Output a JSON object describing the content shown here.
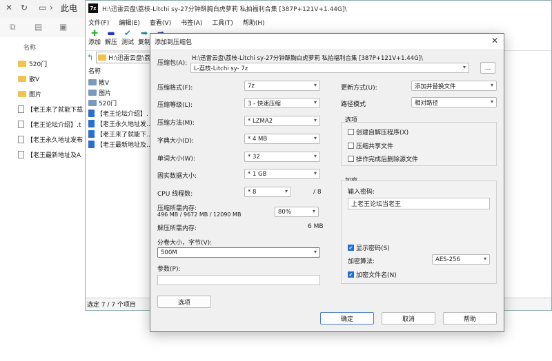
{
  "explorer": {
    "path": "此电",
    "header": "名称",
    "items": [
      {
        "label": "520门",
        "kind": "folder"
      },
      {
        "label": "散V",
        "kind": "folder"
      },
      {
        "label": "图片",
        "kind": "folder"
      },
      {
        "label": "【老王来了就能下载",
        "kind": "doc"
      },
      {
        "label": "【老王论坛介绍】.t",
        "kind": "doc"
      },
      {
        "label": "【老王永久地址发布",
        "kind": "doc"
      },
      {
        "label": "【老王最新地址及A",
        "kind": "doc"
      }
    ]
  },
  "fm": {
    "logo": "7z",
    "title": "H:\\迅雷云盘\\荔枝-Litchi sy-27分钟酥胸白虎萝莉 私拍福利合集 [387P+121V+1.44G]\\",
    "menu": [
      "文件(F)",
      "编辑(E)",
      "查看(V)",
      "书签(A)",
      "工具(T)",
      "帮助(H)"
    ],
    "tools": [
      {
        "label": "添加",
        "icon": "plus-icon",
        "glyph": "✚",
        "color": "#2bb32b"
      },
      {
        "label": "解压",
        "icon": "minus-icon",
        "glyph": "▬",
        "color": "#2233cc"
      },
      {
        "label": "测试",
        "icon": "check-icon",
        "glyph": "✔",
        "color": "#1aa0a0"
      },
      {
        "label": "复制",
        "icon": "copy-arrow-icon",
        "glyph": "➡",
        "color": "#1a8a8a"
      },
      {
        "label": "移",
        "icon": "move-arrow-icon",
        "glyph": "➡",
        "color": "#223399"
      }
    ],
    "address": "H:\\迅雷云盘\\荔",
    "list_header": "名称",
    "rows": [
      {
        "label": "散V",
        "kind": "folder"
      },
      {
        "label": "图片",
        "kind": "folder"
      },
      {
        "label": "520门",
        "kind": "folder"
      },
      {
        "label": "【老王论坛介绍】.",
        "kind": "doc"
      },
      {
        "label": "【老王永久地址发..",
        "kind": "doc"
      },
      {
        "label": "【老王来了就能下..",
        "kind": "doc"
      },
      {
        "label": "【老王最新地址及..",
        "kind": "doc"
      }
    ],
    "status": "选定 7 / 7 个项目"
  },
  "dialog": {
    "title": "添加到压缩包",
    "archive_label": "压缩包(A):",
    "archive_path": "H:\\迅雷云盘\\荔枝-Litchi sy-27分钟酥胸白虎萝莉 私拍福利合集 [387P+121V+1.44G]\\",
    "archive_name": "L-荔枝-Litchi sy- 7z",
    "browse": "...",
    "format_label": "压缩格式(F):",
    "format": "7z",
    "level_label": "压缩等级(L):",
    "level": "3 - 快速压缩",
    "method_label": "压缩方法(M):",
    "method": "* LZMA2",
    "dict_label": "字典大小(D):",
    "dict": "* 4 MB",
    "word_label": "单词大小(W):",
    "word": "* 32",
    "solid_label": "固实数据大小:",
    "solid": "* 1 GB",
    "cpu_label": "CPU 线程数:",
    "cpu": "* 8",
    "cpu_total": "/ 8",
    "mem_label": "压缩所需内存:",
    "mem_values": "496 MB / 9672 MB / 12090 MB",
    "mem_pct": "80%",
    "decomp_label": "解压所需内存:",
    "decomp_value": "6 MB",
    "volume_label": "分卷大小，字节(V):",
    "volume": "500M",
    "params_label": "参数(P):",
    "params": "",
    "options_btn": "选项",
    "update_label": "更新方式(U):",
    "update": "添加并替换文件",
    "path_label": "路径模式",
    "path_mode": "相对路径",
    "options_group": "选项",
    "opt_sfx": "创建自解压程序(X)",
    "opt_shared": "压缩共享文件",
    "opt_delete": "操作完成后删除源文件",
    "enc_group": "加密",
    "enc_pw_label": "输入密码:",
    "enc_pw": "上老王论坛当老王",
    "show_pw": "显示密码(S)",
    "enc_method_label": "加密算法:",
    "enc_method": "AES-256",
    "enc_names": "加密文件名(N)",
    "ok": "确定",
    "cancel": "取消",
    "help": "帮助"
  }
}
